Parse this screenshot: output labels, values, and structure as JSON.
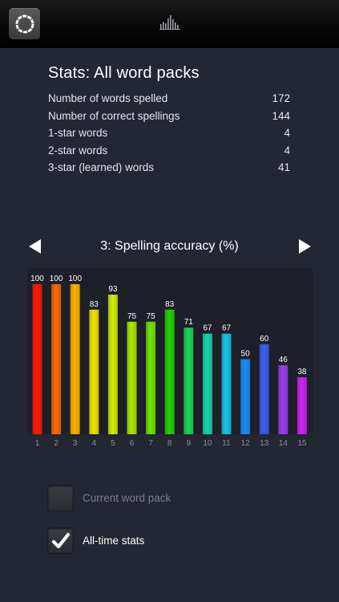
{
  "toolbar": {
    "refresh_icon": "refresh-ring-icon",
    "stats_icon": "bar-chart-icon"
  },
  "stats": {
    "title": "Stats: All word packs",
    "rows": [
      {
        "label": "Number of words spelled",
        "value": "172"
      },
      {
        "label": "Number of correct spellings",
        "value": "144"
      },
      {
        "label": "1-star words",
        "value": "4"
      },
      {
        "label": "2-star words",
        "value": "4"
      },
      {
        "label": "3-star (learned) words",
        "value": "41"
      }
    ]
  },
  "chart_header": {
    "title": "3: Spelling accuracy (%)",
    "prev_icon": "triangle-left-icon",
    "next_icon": "triangle-right-icon"
  },
  "chart_data": {
    "type": "bar",
    "title": "3: Spelling accuracy (%)",
    "categories": [
      "1",
      "2",
      "3",
      "4",
      "5",
      "6",
      "7",
      "8",
      "9",
      "10",
      "11",
      "12",
      "13",
      "14",
      "15"
    ],
    "values": [
      100,
      100,
      100,
      83,
      93,
      75,
      75,
      83,
      71,
      67,
      67,
      50,
      60,
      46,
      38
    ],
    "ylim": [
      0,
      100
    ],
    "colors": [
      "#ff1a00",
      "#ff6a00",
      "#ffb300",
      "#f2e400",
      "#d4f000",
      "#a8ec00",
      "#72e600",
      "#22d400",
      "#19d850",
      "#18d6a8",
      "#18c4e8",
      "#1a8ef5",
      "#3a60f0",
      "#9a3cf0",
      "#d020f5"
    ],
    "grid": false,
    "legend": "none"
  },
  "options": {
    "current_pack": {
      "label": "Current word pack",
      "checked": false
    },
    "all_time": {
      "label": "All-time stats",
      "checked": true,
      "check_icon": "checkmark-icon"
    }
  }
}
